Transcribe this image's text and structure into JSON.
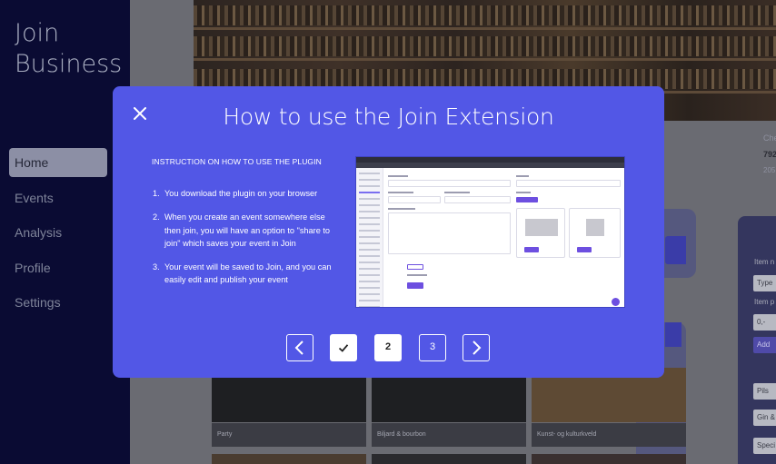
{
  "sidebar": {
    "brand": "Join Business",
    "items": [
      {
        "label": "Home",
        "active": true
      },
      {
        "label": "Events"
      },
      {
        "label": "Analysis"
      },
      {
        "label": "Profile"
      },
      {
        "label": "Settings"
      }
    ]
  },
  "background": {
    "event_cards": [
      "Party",
      "Biljard & bourbon",
      "Kunst- og kulturkveld"
    ],
    "right_panel": {
      "labels": [
        "Item n",
        "Item p"
      ],
      "inputs": [
        "Type",
        "0,-"
      ],
      "add_button": "Add",
      "options": [
        "Pils",
        "Gin &",
        "Speci"
      ]
    },
    "header_partial": [
      "Che",
      "792",
      "205"
    ]
  },
  "modal": {
    "title": "How to use the Join Extension",
    "instruction_heading": "INSTRUCTION ON HOW TO USE THE PLUGIN",
    "steps": [
      {
        "num": "1.",
        "text": "You download the plugin on your browser"
      },
      {
        "num": "2.",
        "text": "When you create an event somewhere else then join, you will have an option to \"share to join\" which saves your event in Join"
      },
      {
        "num": "3.",
        "text": "Your event will be saved to Join, and you can easily edit and publish your event"
      }
    ],
    "pagination": {
      "pages": [
        "2",
        "3"
      ],
      "current": "2"
    }
  },
  "colors": {
    "modal_bg": "#5257e6",
    "sidebar_bg": "#0a0b33",
    "accent": "#3a3ca8"
  },
  "icons": [
    "close-icon",
    "chevron-left-icon",
    "check-icon",
    "chevron-right-icon"
  ]
}
